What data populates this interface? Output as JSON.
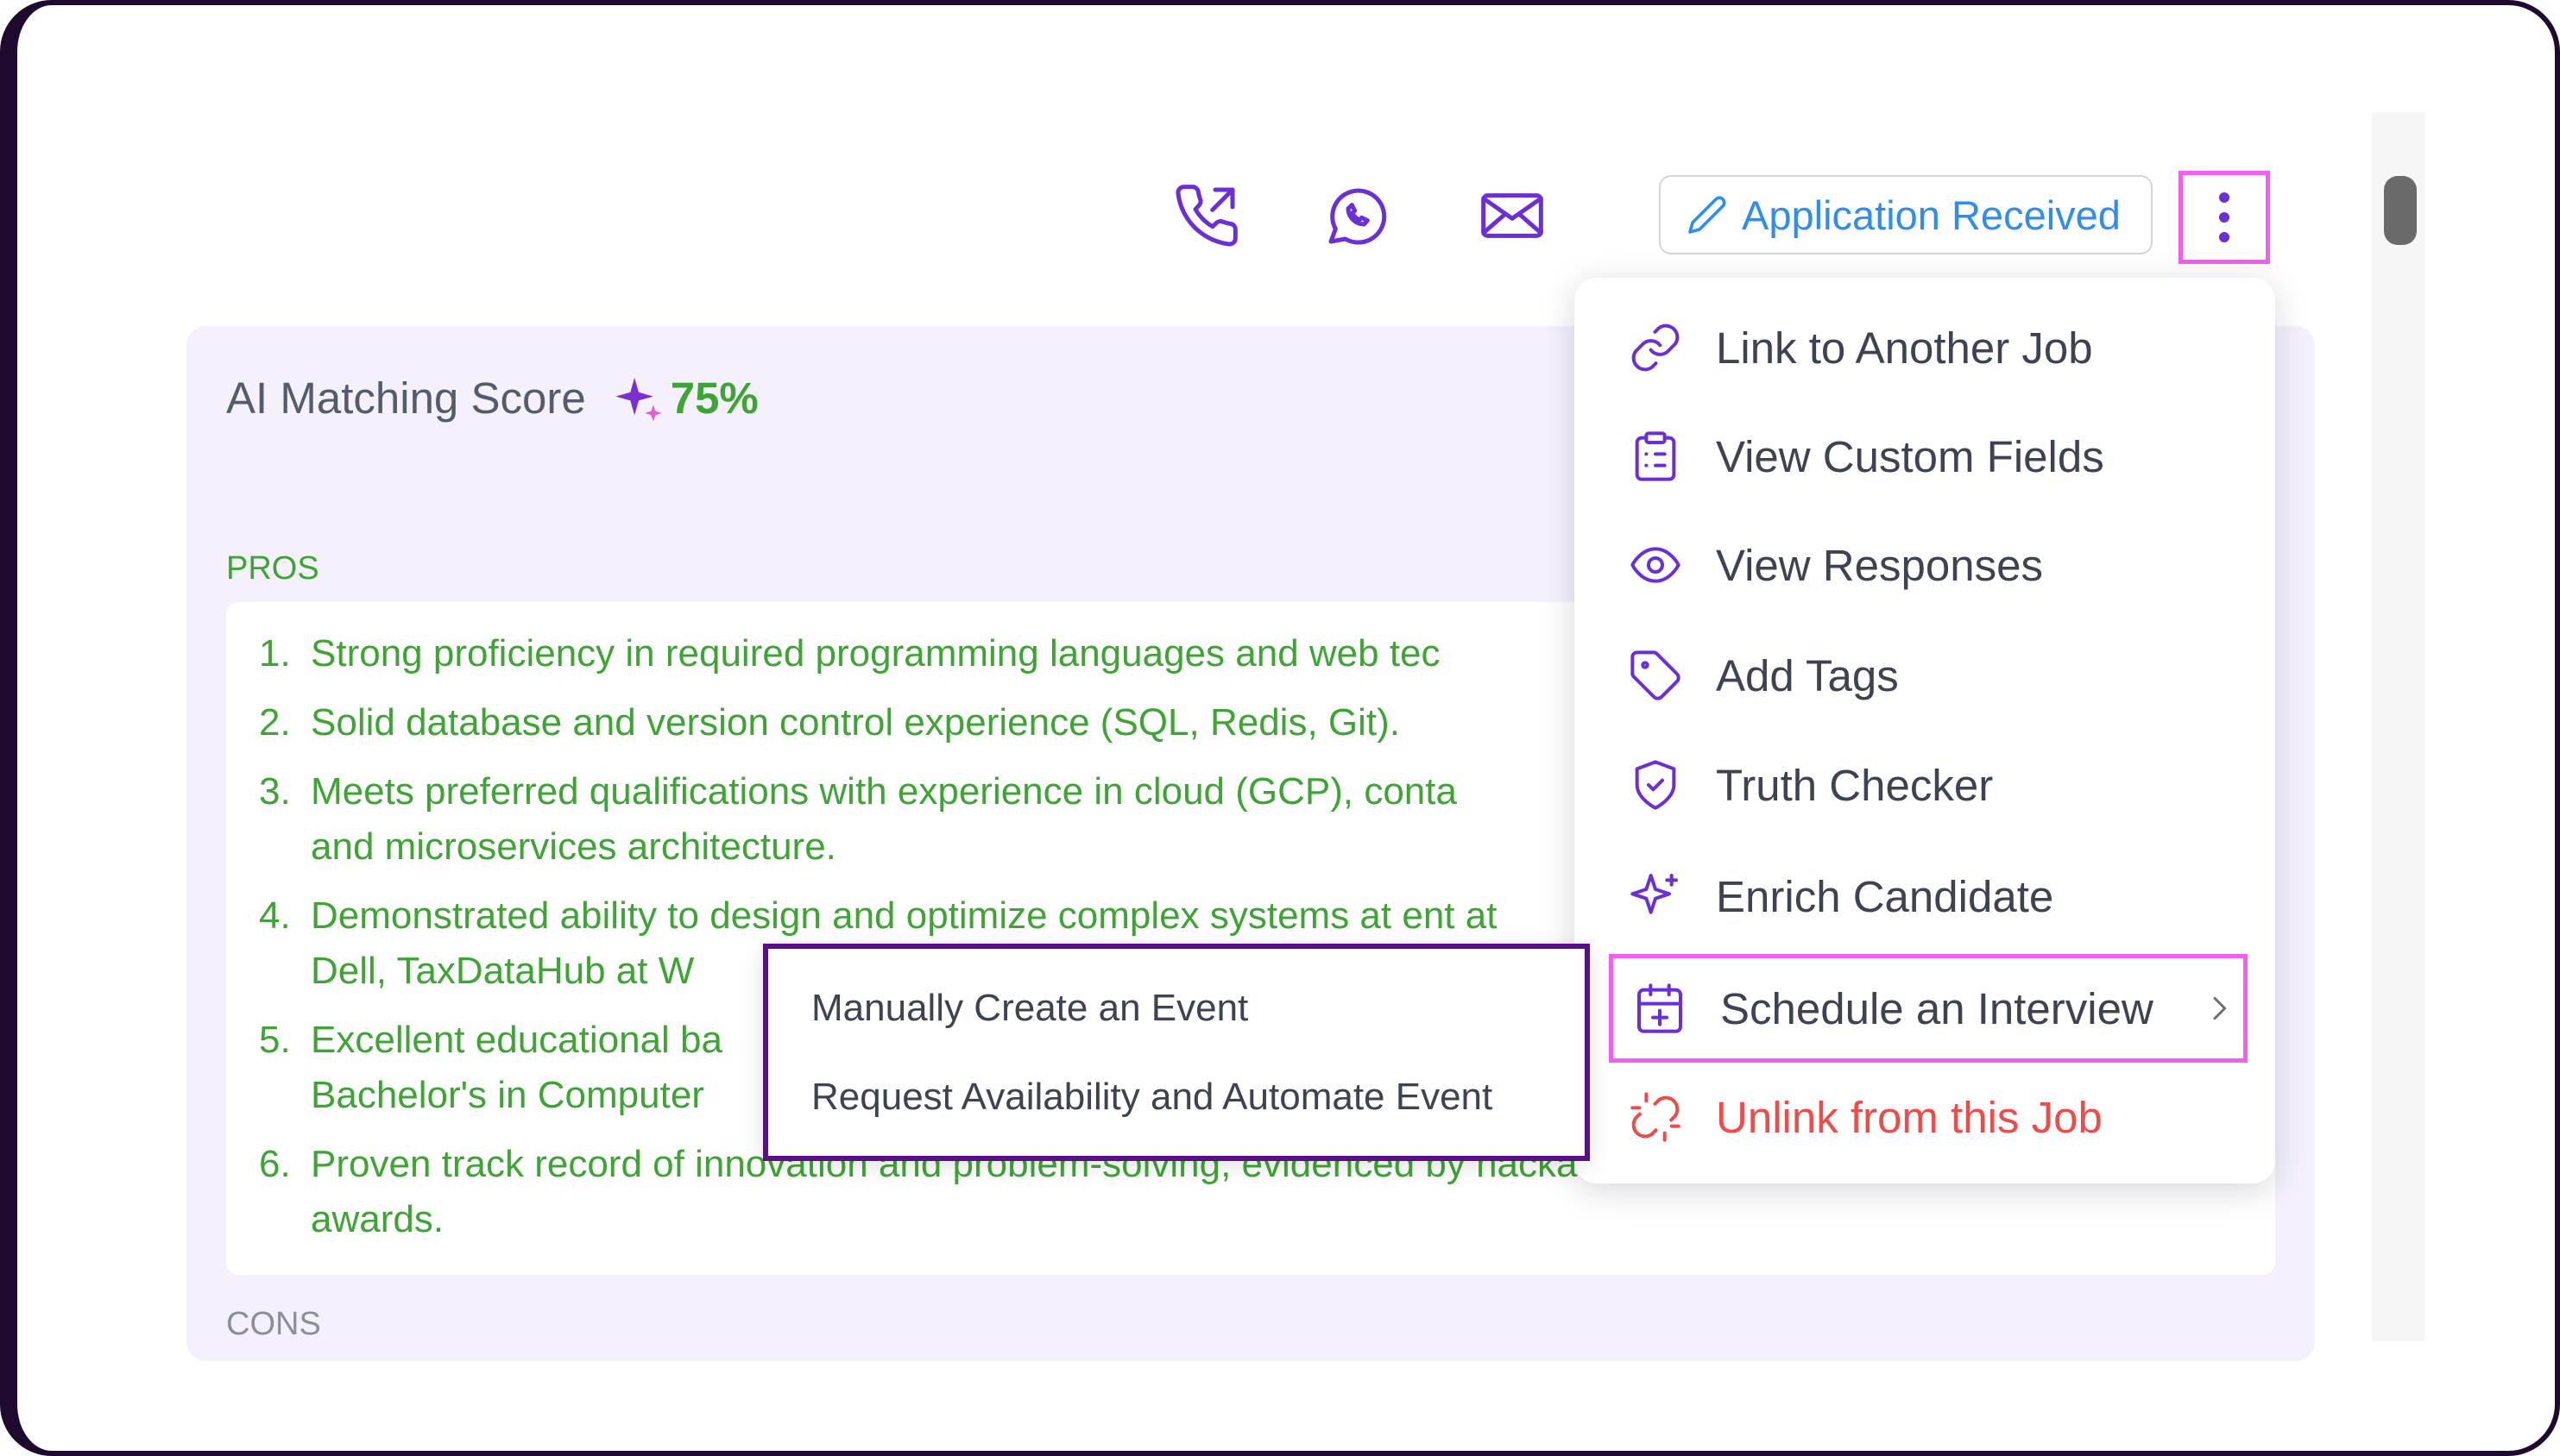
{
  "header": {
    "action_icons": [
      "phone-outgoing-icon",
      "whatsapp-icon",
      "mail-icon"
    ],
    "status_label": "Application Received",
    "status_icon": "pencil-icon",
    "more_icon": "kebab-vertical-icon"
  },
  "score": {
    "label": "AI Matching Score",
    "value": "75%",
    "icon": "sparkles-icon"
  },
  "pros": {
    "label": "PROS",
    "items": [
      {
        "num": "1.",
        "text": "Strong proficiency in required programming languages and web tec"
      },
      {
        "num": "2.",
        "text": "Solid database and version control experience (SQL, Redis, Git)."
      },
      {
        "num": "3.",
        "text": "Meets preferred qualifications with experience in cloud (GCP), conta and microservices architecture."
      },
      {
        "num": "4.",
        "text": "Demonstrated ability to design and optimize complex systems at ent at Dell, TaxDataHub at W"
      },
      {
        "num": "5.",
        "text": "Excellent educational ba Bachelor's in Computer"
      },
      {
        "num": "6.",
        "text": "Proven track record of innovation and problem-solving, evidenced by hackathon awards."
      }
    ]
  },
  "cons": {
    "label": "CONS"
  },
  "menu": {
    "items": [
      {
        "label": "Link to Another Job",
        "icon": "link-icon"
      },
      {
        "label": "View Custom Fields",
        "icon": "clipboard-list-icon"
      },
      {
        "label": "View Responses",
        "icon": "eye-icon"
      },
      {
        "label": "Add Tags",
        "icon": "tag-icon"
      },
      {
        "label": "Truth Checker",
        "icon": "shield-check-icon"
      },
      {
        "label": "Enrich Candidate",
        "icon": "sparkle-icon"
      },
      {
        "label": "Schedule an Interview",
        "icon": "calendar-plus-icon"
      },
      {
        "label": "Unlink from this Job",
        "icon": "unlink-icon"
      }
    ]
  },
  "submenu": {
    "items": [
      {
        "label": "Manually Create an Event"
      },
      {
        "label": "Request Availability and Automate Event"
      }
    ]
  },
  "colors": {
    "accent": "#6b2fd6",
    "success": "#3ea535",
    "danger": "#ee4b4b",
    "highlight": "#f55ef0",
    "status_blue": "#2f8df0"
  }
}
